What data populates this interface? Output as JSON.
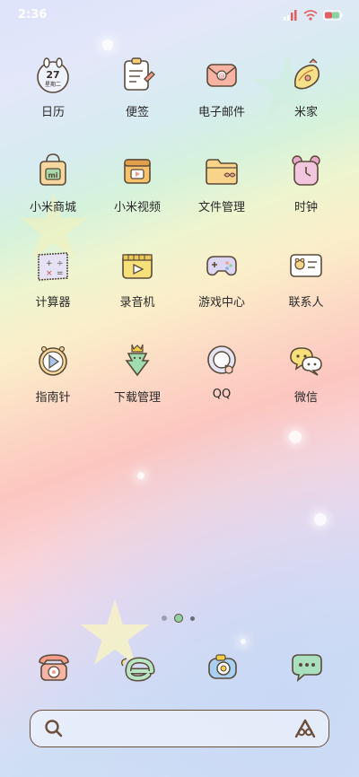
{
  "status_bar": {
    "time": "2:36",
    "icons": [
      "signal-icon",
      "wifi-icon",
      "battery-icon"
    ]
  },
  "apps": [
    {
      "label": "日历",
      "icon": "calendar-icon",
      "day_number": "27",
      "weekday": "星期二"
    },
    {
      "label": "便签",
      "icon": "notes-icon"
    },
    {
      "label": "电子邮件",
      "icon": "email-icon"
    },
    {
      "label": "米家",
      "icon": "mijia-icon"
    },
    {
      "label": "小米商城",
      "icon": "mall-icon"
    },
    {
      "label": "小米视频",
      "icon": "video-icon"
    },
    {
      "label": "文件管理",
      "icon": "folder-icon"
    },
    {
      "label": "时钟",
      "icon": "alarm-clock-icon"
    },
    {
      "label": "计算器",
      "icon": "calculator-icon"
    },
    {
      "label": "录音机",
      "icon": "recorder-icon"
    },
    {
      "label": "游戏中心",
      "icon": "gamepad-icon"
    },
    {
      "label": "联系人",
      "icon": "contacts-icon"
    },
    {
      "label": "指南针",
      "icon": "compass-icon"
    },
    {
      "label": "下载管理",
      "icon": "download-icon"
    },
    {
      "label": "QQ",
      "icon": "qq-icon"
    },
    {
      "label": "微信",
      "icon": "wechat-icon"
    }
  ],
  "dock": [
    {
      "icon": "phone-icon"
    },
    {
      "icon": "browser-icon"
    },
    {
      "icon": "camera-icon"
    },
    {
      "icon": "messages-icon"
    }
  ],
  "search_bar": {
    "left_icon": "search-icon",
    "right_icon": "assistant-icon"
  },
  "page_indicator": {
    "pages": 2,
    "current": 1
  }
}
